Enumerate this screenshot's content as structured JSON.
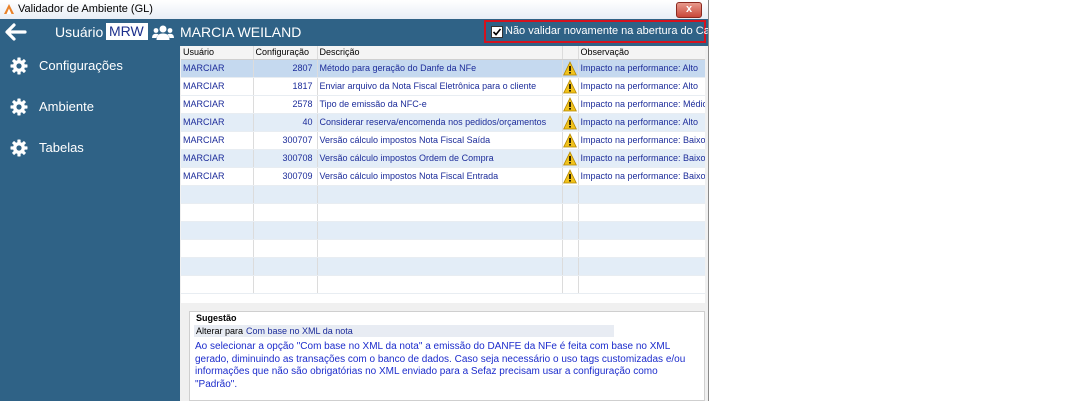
{
  "window": {
    "title": "Validador de Ambiente (GL)",
    "close_glyph": "x"
  },
  "header": {
    "user_label": "Usuário",
    "user_code": "MRW",
    "user_name": "MARCIA WEILAND",
    "checkbox_label": "Não validar novamente na abertura do Caixa",
    "checkbox_checked": true,
    "highlight_color": "#d4121e",
    "bar_color": "#2f6286"
  },
  "sidebar": {
    "items": [
      {
        "label": "Configurações",
        "icon": "gear-icon"
      },
      {
        "label": "Ambiente",
        "icon": "gear-icon"
      },
      {
        "label": "Tabelas",
        "icon": "gear-icon"
      }
    ]
  },
  "grid": {
    "columns": [
      "Usuário",
      "Configuração",
      "Descrição",
      "",
      "Observação"
    ],
    "rows": [
      {
        "user": "MARCIAR",
        "config": "2807",
        "desc": "Método para geração do Danfe da NFe",
        "icon": "warning-icon",
        "obs": "Impacto na performance: Alto"
      },
      {
        "user": "MARCIAR",
        "config": "1817",
        "desc": "Enviar arquivo da Nota Fiscal Eletrônica para o cliente",
        "icon": "warning-icon",
        "obs": "Impacto na performance: Alto"
      },
      {
        "user": "MARCIAR",
        "config": "2578",
        "desc": "Tipo de emissão da NFC-e",
        "icon": "warning-icon",
        "obs": "Impacto na performance: Médio"
      },
      {
        "user": "MARCIAR",
        "config": "40",
        "desc": "Considerar reserva/encomenda nos pedidos/orçamentos",
        "icon": "warning-icon",
        "obs": "Impacto na performance: Alto"
      },
      {
        "user": "MARCIAR",
        "config": "300707",
        "desc": "Versão cálculo impostos Nota Fiscal Saída",
        "icon": "warning-icon",
        "obs": "Impacto na performance: Baixo"
      },
      {
        "user": "MARCIAR",
        "config": "300708",
        "desc": "Versão cálculo impostos Ordem de Compra",
        "icon": "warning-icon",
        "obs": "Impacto na performance: Baixo"
      },
      {
        "user": "MARCIAR",
        "config": "300709",
        "desc": "Versão cálculo impostos Nota Fiscal Entrada",
        "icon": "warning-icon",
        "obs": "Impacto na performance: Baixo"
      }
    ],
    "empty_rows": 6
  },
  "suggestion": {
    "title": "Sugestão",
    "alter_label": "Alterar para",
    "alter_value": "Com base no XML da nota",
    "description": "Ao selecionar a opção \"Com base no XML da nota\" a emissão do DANFE da NFe é feita com base no XML gerado, diminuindo as transações com o banco de dados. Caso seja necessário o uso tags customizadas e/ou informações que não são obrigatórias no XML enviado para a Sefaz precisam usar a configuração como \"Padrão\"."
  }
}
